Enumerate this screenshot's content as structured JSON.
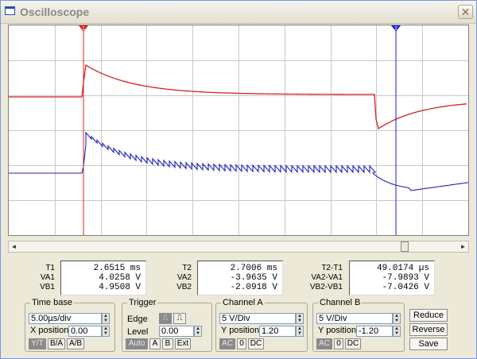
{
  "window": {
    "title": "Oscilloscope",
    "close_glyph": "✕"
  },
  "cursors": {
    "c1_label": "1",
    "c2_label": "2",
    "c1_color": "#e02020",
    "c2_color": "#2020d0"
  },
  "traces": {
    "channel_a_color": "#d42020",
    "channel_b_color": "#2020b8"
  },
  "readout": {
    "t1_label": "T1",
    "t1_value": "2.6515 ms",
    "va1_label": "VA1",
    "va1_value": "4.0258 V",
    "vb1_label": "VB1",
    "vb1_value": "4.9508 V",
    "t2_label": "T2",
    "t2_value": "2.7006 ms",
    "va2_label": "VA2",
    "va2_value": "-3.9635 V",
    "vb2_label": "VB2",
    "vb2_value": "-2.0918 V",
    "dt_label": "T2-T1",
    "dt_value": "49.0174 µs",
    "dva_label": "VA2-VA1",
    "dva_value": "-7.9893 V",
    "dvb_label": "VB2-VB1",
    "dvb_value": "-7.0426 V"
  },
  "timebase": {
    "title": "Time base",
    "scale": "5.00µs/div",
    "xpos_label": "X position",
    "xpos": "0.00",
    "modes": [
      "Y/T",
      "B/A",
      "A/B"
    ]
  },
  "trigger": {
    "title": "Trigger",
    "edge_label": "Edge",
    "level_label": "Level",
    "level": "0.00",
    "sources": [
      "Auto",
      "A",
      "B",
      "Ext"
    ]
  },
  "channel_a": {
    "title": "Channel A",
    "scale": "5 V/Div",
    "ypos_label": "Y position",
    "ypos": "1.20",
    "coupling": [
      "AC",
      "0",
      "DC"
    ]
  },
  "channel_b": {
    "title": "Channel B",
    "scale": "5 V/Div",
    "ypos_label": "Y position",
    "ypos": "-1.20",
    "coupling": [
      "AC",
      "0",
      "DC"
    ]
  },
  "actions": {
    "reduce": "Reduce",
    "reverse": "Reverse",
    "save": "Save"
  },
  "scroll": {
    "left": "◄",
    "right": "►"
  }
}
